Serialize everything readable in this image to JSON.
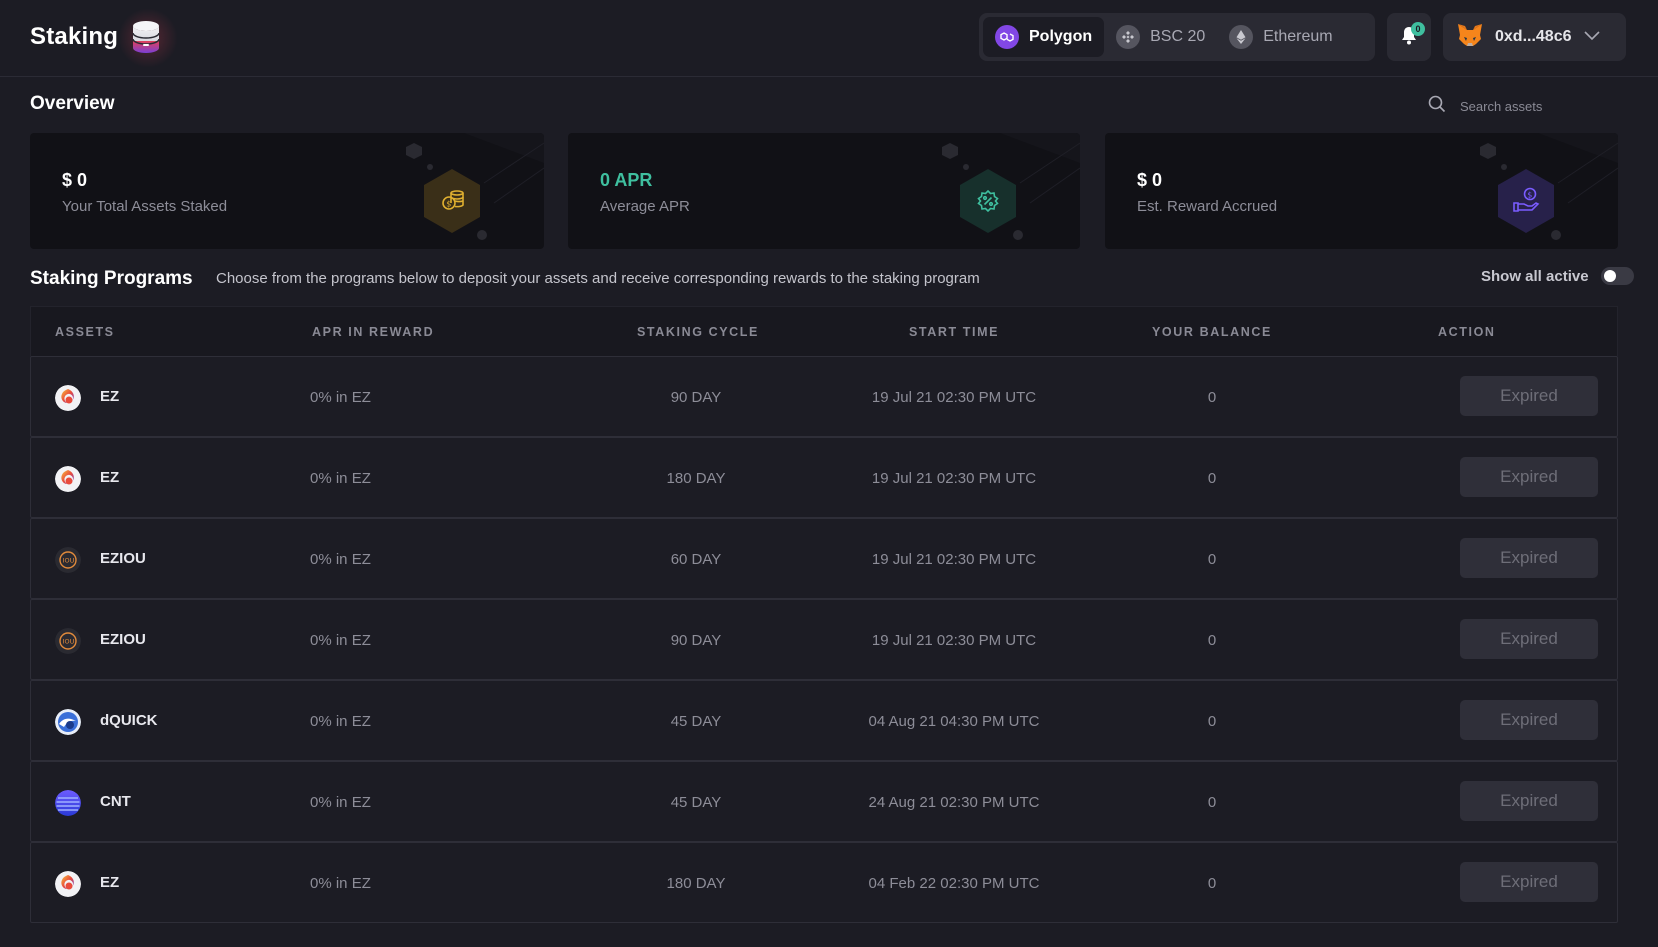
{
  "header": {
    "title": "Staking",
    "networks": [
      {
        "label": "Polygon",
        "icon": "polygon-icon",
        "active": true,
        "color": "#8247e5"
      },
      {
        "label": "BSC 20",
        "icon": "bsc-icon",
        "active": false,
        "color": "#8a8a95"
      },
      {
        "label": "Ethereum",
        "icon": "ethereum-icon",
        "active": false,
        "color": "#8a8a95"
      }
    ],
    "notifications_count": "0",
    "wallet_address": "0xd...48c6"
  },
  "overview": {
    "title": "Overview",
    "search_placeholder": "Search assets",
    "cards": [
      {
        "value": "$ 0",
        "label": "Your Total Assets Staked",
        "icon": "coins-icon",
        "accent": "#d9a520"
      },
      {
        "value": "0 APR",
        "label": "Average APR",
        "icon": "percent-badge-icon",
        "accent": "#3fbf9f"
      },
      {
        "value": "$ 0",
        "label": "Est. Reward Accrued",
        "icon": "hand-coin-icon",
        "accent": "#7a5cff"
      }
    ]
  },
  "programs": {
    "title": "Staking Programs",
    "description": "Choose from the programs below to deposit your assets and receive corresponding rewards to the staking program",
    "toggle_label": "Show all active",
    "toggle_on": false,
    "columns": [
      "ASSETS",
      "APR IN REWARD",
      "STAKING CYCLE",
      "START TIME",
      "YOUR BALANCE",
      "ACTION"
    ],
    "rows": [
      {
        "asset": "EZ",
        "icon": "ez-token-icon",
        "apr": "0% in EZ",
        "cycle": "90 DAY",
        "start": "19 Jul 21 02:30 PM UTC",
        "balance": "0",
        "action": "Expired"
      },
      {
        "asset": "EZ",
        "icon": "ez-token-icon",
        "apr": "0% in EZ",
        "cycle": "180 DAY",
        "start": "19 Jul 21 02:30 PM UTC",
        "balance": "0",
        "action": "Expired"
      },
      {
        "asset": "EZIOU",
        "icon": "eziou-token-icon",
        "apr": "0% in EZ",
        "cycle": "60 DAY",
        "start": "19 Jul 21 02:30 PM UTC",
        "balance": "0",
        "action": "Expired"
      },
      {
        "asset": "EZIOU",
        "icon": "eziou-token-icon",
        "apr": "0% in EZ",
        "cycle": "90 DAY",
        "start": "19 Jul 21 02:30 PM UTC",
        "balance": "0",
        "action": "Expired"
      },
      {
        "asset": "dQUICK",
        "icon": "dquick-token-icon",
        "apr": "0% in EZ",
        "cycle": "45 DAY",
        "start": "04 Aug 21 04:30 PM UTC",
        "balance": "0",
        "action": "Expired"
      },
      {
        "asset": "CNT",
        "icon": "cnt-token-icon",
        "apr": "0% in EZ",
        "cycle": "45 DAY",
        "start": "24 Aug 21 02:30 PM UTC",
        "balance": "0",
        "action": "Expired"
      },
      {
        "asset": "EZ",
        "icon": "ez-token-icon",
        "apr": "0% in EZ",
        "cycle": "180 DAY",
        "start": "04 Feb 22 02:30 PM UTC",
        "balance": "0",
        "action": "Expired"
      }
    ]
  }
}
